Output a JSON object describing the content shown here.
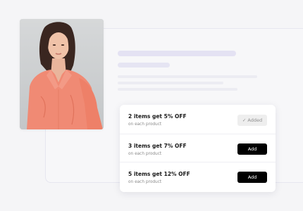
{
  "icons": {
    "added_check": "check-icon"
  },
  "colors": {
    "button_primary": "#000000",
    "button_added": "#eeeeee",
    "shirt": "#f08a74"
  },
  "offers": [
    {
      "title": "2 items get 5% OFF",
      "subtitle": "on each product",
      "button": "Added",
      "state": "added",
      "check": "✓"
    },
    {
      "title": "3 items get 7% OFF",
      "subtitle": "on each product",
      "button": "Add",
      "state": "add"
    },
    {
      "title": "5 items get 12% OFF",
      "subtitle": "on each product",
      "button": "Add",
      "state": "add"
    }
  ]
}
